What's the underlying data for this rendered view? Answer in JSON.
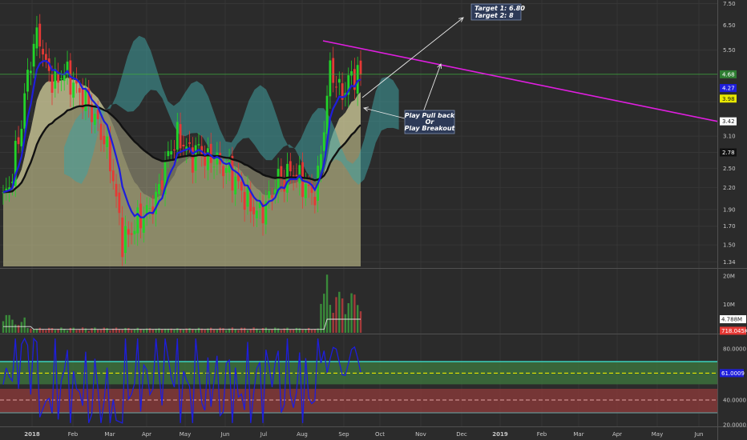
{
  "chart_data": [
    {
      "type": "candlestick",
      "panel": "price",
      "yscale": "log",
      "ylim": [
        1.3,
        7.6
      ],
      "y_ticks": [
        "7.50",
        "6.50",
        "5.50",
        "4.27",
        "3.98",
        "3.42",
        "3.10",
        "2.78",
        "2.50",
        "2.20",
        "1.90",
        "1.70",
        "1.50",
        "1.34"
      ],
      "x_ticks": [
        "2018",
        "Feb",
        "Mar",
        "Apr",
        "May",
        "Jun",
        "Jul",
        "Aug",
        "Sep",
        "Oct",
        "Nov",
        "Dec",
        "2019",
        "Feb",
        "Mar",
        "Apr",
        "May",
        "Jun"
      ],
      "ohlc_closes": [
        2.05,
        2.2,
        2.7,
        3.3,
        4.5,
        5.6,
        6.2,
        5.0,
        4.6,
        4.4,
        4.8,
        4.6,
        4.3,
        4.1,
        3.9,
        3.6,
        3.3,
        3.0,
        2.6,
        2.0,
        1.55,
        1.6,
        1.7,
        1.8,
        1.85,
        1.95,
        2.1,
        2.5,
        2.8,
        3.1,
        3.0,
        2.8,
        2.7,
        2.9,
        2.6,
        2.7,
        2.6,
        2.5,
        2.45,
        2.3,
        2.15,
        2.0,
        1.9,
        1.85,
        1.95,
        2.1,
        2.35,
        2.3,
        2.45,
        2.4,
        2.3,
        2.2,
        2.05,
        2.4,
        3.5,
        5.0,
        4.3,
        4.1,
        4.5,
        4.7,
        4.62
      ],
      "price_tags": [
        {
          "label": "4.68",
          "bg": "#2e7d32",
          "color": "#ffffff"
        },
        {
          "label": "4.27",
          "bg": "#1e1edc",
          "color": "#ffffff"
        },
        {
          "label": "3.98",
          "bg": "#e8e800",
          "color": "#1a1a1a"
        },
        {
          "label": "3.42",
          "bg": "#ffffff",
          "color": "#1a1a1a"
        },
        {
          "label": "2.78",
          "bg": "#111111",
          "color": "#ffffff"
        }
      ],
      "annotations": [
        {
          "text": [
            "Target 1: 6.80",
            "Target 2: 8"
          ]
        },
        {
          "text": [
            "Play Pull back",
            "Or",
            "Play Breakout"
          ]
        }
      ],
      "colors": {
        "up": "#22d428",
        "down": "#e53935",
        "ma_fast": "#1e1edc",
        "ma_slow": "#111111",
        "trendline": "#e01ee0",
        "cloud": "#3fa0a0"
      }
    },
    {
      "type": "bar",
      "panel": "volume",
      "y_ticks": [
        "20M",
        "10M"
      ],
      "value_tags": [
        {
          "label": "4.788M",
          "bg": "#ffffff",
          "color": "#1a1a1a"
        },
        {
          "label": "718.045K",
          "bg": "#e53935",
          "color": "#ffffff"
        }
      ]
    },
    {
      "type": "line",
      "panel": "rsi",
      "ylim": [
        20,
        90
      ],
      "y_ticks": [
        "80.0000",
        "40.0000",
        "20.0000"
      ],
      "rsi_tag": {
        "label": "61.0009",
        "bg": "#1e1edc",
        "color": "#ffffff"
      },
      "levels": {
        "upper": 70,
        "mid_upper": 61,
        "mid_lower": 40,
        "lower": 30
      },
      "colors": {
        "line": "#1e1edc",
        "upper_band": "#3f7a3f",
        "lower_band": "#8a3a3a",
        "level": "#e6e600",
        "upper_line": "#3ad1c0"
      }
    }
  ]
}
